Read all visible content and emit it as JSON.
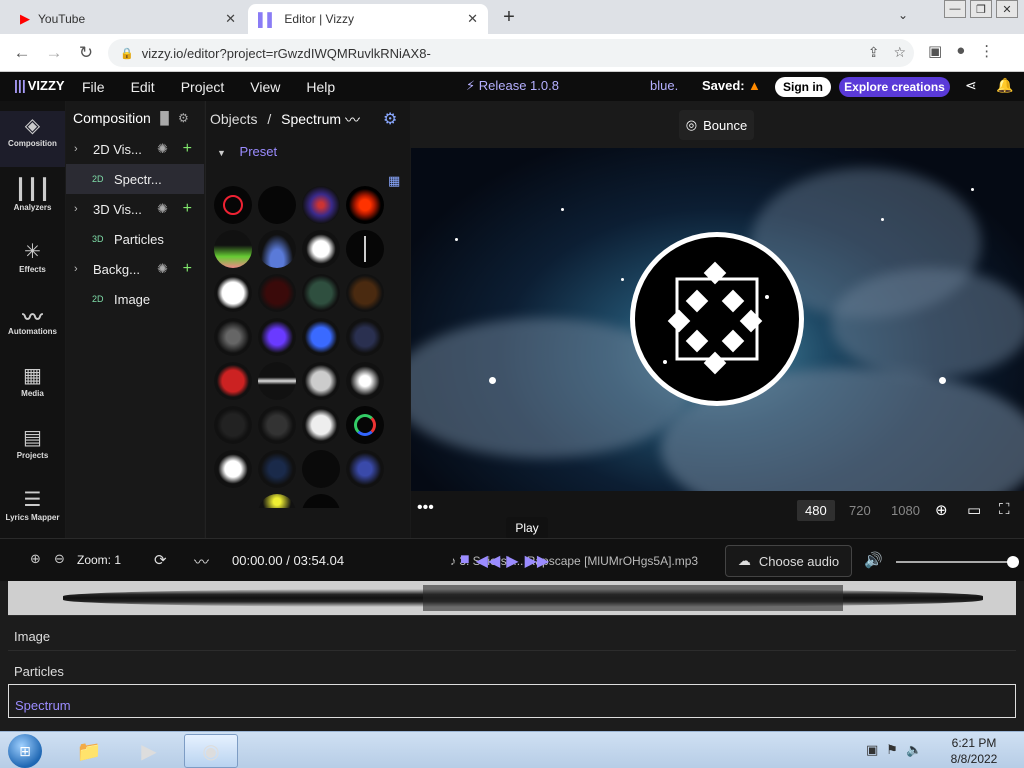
{
  "browser": {
    "tabs": [
      {
        "title": "YouTube",
        "icon": "youtube-icon"
      },
      {
        "title": "Editor | Vizzy",
        "icon": "vizzy-icon"
      }
    ],
    "url": "vizzy.io/editor?project=rGwzdIWQMRuvlkRNiAX8-"
  },
  "app": {
    "logo": "VIZZY",
    "menu": [
      "File",
      "Edit",
      "Project",
      "View",
      "Help"
    ],
    "release": "⚡ Release 1.0.8",
    "user": "blue.",
    "saved": "Saved:",
    "sign_in": "Sign in",
    "explore": "Explore creations",
    "accent": "#5a3ad8"
  },
  "sidebar": {
    "items": [
      "Composition",
      "Analyzers",
      "Effects",
      "Automations",
      "Media",
      "Projects",
      "Lyrics Mapper"
    ]
  },
  "composition": {
    "title": "Composition",
    "tree": [
      {
        "name": "2D Vis...",
        "type": "group"
      },
      {
        "name": "Spectr...",
        "badge": "2D",
        "selected": true
      },
      {
        "name": "3D Vis...",
        "type": "group"
      },
      {
        "name": "Particles",
        "badge": "3D"
      },
      {
        "name": "Backg...",
        "type": "group"
      },
      {
        "name": "Image",
        "badge": "2D"
      }
    ]
  },
  "objects": {
    "breadcrumb_root": "Objects",
    "breadcrumb_sep": "/",
    "breadcrumb_current": "Spectrum",
    "preset_label": "Preset"
  },
  "preview": {
    "bounce_label": "Bounce",
    "resolutions": [
      "480",
      "720",
      "1080"
    ],
    "selected_resolution": "480"
  },
  "tooltip": "Play",
  "transport": {
    "zoom": "Zoom: 1",
    "time": "00:00.00 / 03:54.04",
    "file": "♪ 3. Seiersh... Rapscape [MlUMrOHgs5A].mp3",
    "choose_audio": "Choose audio"
  },
  "timeline": {
    "tracks": [
      "Image",
      "Particles",
      "Spectrum"
    ],
    "selected_track": "Spectrum"
  },
  "taskbar": {
    "time": "6:21 PM",
    "date": "8/8/2022"
  }
}
